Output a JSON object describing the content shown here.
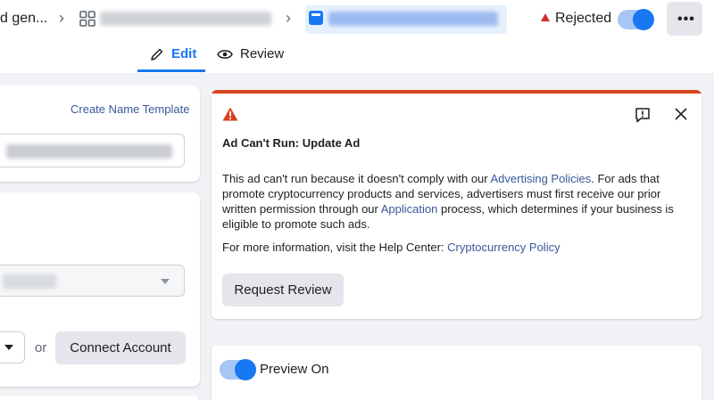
{
  "breadcrumb": {
    "first_label": "d gen...",
    "chevron": "›",
    "second_icon": "grid-icon",
    "active_icon": "document-icon"
  },
  "header": {
    "status_label": "Rejected",
    "status_color": "#c8302d",
    "toggle_on": true,
    "more_label": "•••",
    "accent": "#1877f2"
  },
  "tabs": [
    {
      "label": "Edit",
      "active": true
    },
    {
      "label": "Review",
      "active": false
    }
  ],
  "left": {
    "create_template_label": "Create Name Template",
    "or_label": "or",
    "connect_label": "Connect Account"
  },
  "alert": {
    "title": "Ad Can't Run: Update Ad",
    "body_pre": "This ad can't run because it doesn't comply with our ",
    "link_policies": "Advertising Policies",
    "body_mid": ". For ads that promote cryptocurrency products and services, advertisers must first receive our prior written permission through our ",
    "link_application": "Application",
    "body_post": " process, which determines if your business is eligible to promote such ads.",
    "more_pre": "For more information, visit the Help Center: ",
    "link_crypto": "Cryptocurrency Policy",
    "request_label": "Request Review",
    "bar_color": "#d8431f"
  },
  "preview": {
    "label": "Preview On",
    "toggle_on": true
  }
}
